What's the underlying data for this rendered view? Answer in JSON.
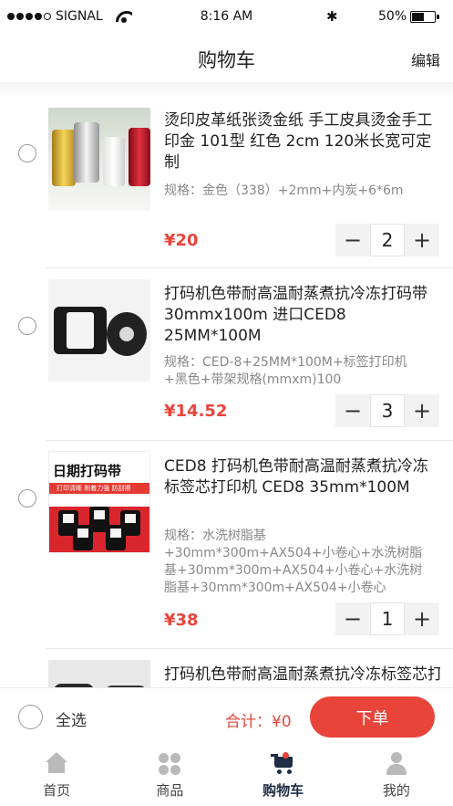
{
  "status_bar": {
    "carrier": "SIGNAL",
    "time": "8:16 AM",
    "battery": "50%",
    "bluetooth_icon": "bluetooth-icon"
  },
  "nav": {
    "title": "购物车",
    "edit_label": "编辑"
  },
  "items": [
    {
      "title": "烫印皮革纸张烫金纸 手工皮具烫金手工印金 101型 红色 2cm 120米长宽可定制",
      "spec": "规格：金色（338）+2mm+内炭+6*6m",
      "price": "¥20",
      "quantity": "2"
    },
    {
      "title": "打码机色带耐高温耐蒸煮抗冷冻打码带30mmx100m 进口CED8 25MM*100M",
      "spec": "规格：CED-8+25MM*100M+标签打印机+黑色+带架规格(mmxm)100",
      "price": "¥14.52",
      "quantity": "3"
    },
    {
      "title": "CED8 打码机色带耐高温耐蒸煮抗冷冻标签芯打印机 CED8 35mm*100M",
      "spec": "规格：水洗树脂基+30mm*300m+AX504+小卷心+水洗树脂基+30mm*300m+AX504+小卷心+水洗树脂基+30mm*300m+AX504+小卷心",
      "price": "¥38",
      "quantity": "1",
      "thumb_banner": "日期打码带",
      "thumb_strip": "打印清晰  附着力强  防刮擦"
    },
    {
      "title": "打码机色带耐高温耐蒸煮抗冷冻标签芯打印机"
    }
  ],
  "stepper": {
    "minus": "−",
    "plus": "+"
  },
  "action_bar": {
    "select_all_label": "全选",
    "total_label": "合计：¥0",
    "submit_label": "下单"
  },
  "tabs": [
    {
      "label": "首页",
      "icon": "home-icon"
    },
    {
      "label": "商品",
      "icon": "grid-icon"
    },
    {
      "label": "购物车",
      "icon": "cart-icon"
    },
    {
      "label": "我的",
      "icon": "user-icon"
    }
  ],
  "colors": {
    "accent": "#e8443a",
    "active_tab": "#1f2d44"
  }
}
